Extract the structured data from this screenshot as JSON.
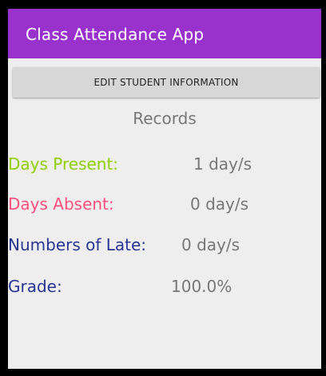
{
  "app_bar": {
    "title": "Class Attendance App",
    "color": "#9932cc"
  },
  "edit_button": {
    "label": "EDIT STUDENT INFORMATION"
  },
  "records": {
    "heading": "Records",
    "days_present": {
      "label": "Days Present:",
      "value": "1 day/s",
      "color": "#8fce00"
    },
    "days_absent": {
      "label": "Days Absent:",
      "value": "0 day/s",
      "color": "#ff4f7b"
    },
    "late": {
      "label": "Numbers of Late:",
      "value": "0 day/s",
      "color": "#283593"
    },
    "grade": {
      "label": "Grade:",
      "value": "100.0%",
      "color": "#283593"
    }
  }
}
